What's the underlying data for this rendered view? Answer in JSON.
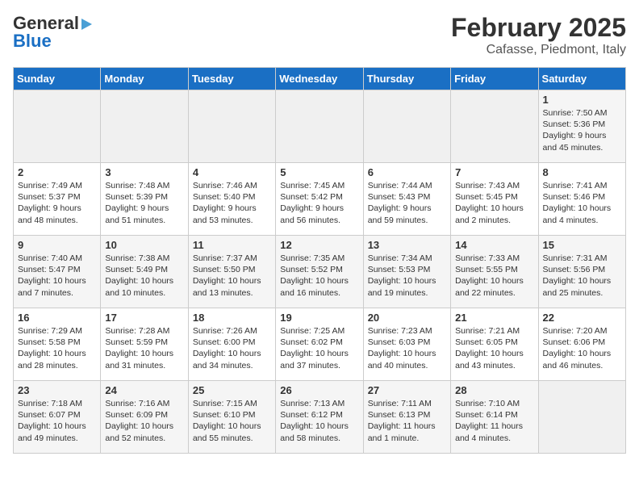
{
  "header": {
    "logo_general": "General",
    "logo_blue": "Blue",
    "title": "February 2025",
    "subtitle": "Cafasse, Piedmont, Italy"
  },
  "days_of_week": [
    "Sunday",
    "Monday",
    "Tuesday",
    "Wednesday",
    "Thursday",
    "Friday",
    "Saturday"
  ],
  "weeks": [
    [
      {
        "day": "",
        "info": ""
      },
      {
        "day": "",
        "info": ""
      },
      {
        "day": "",
        "info": ""
      },
      {
        "day": "",
        "info": ""
      },
      {
        "day": "",
        "info": ""
      },
      {
        "day": "",
        "info": ""
      },
      {
        "day": "1",
        "info": "Sunrise: 7:50 AM\nSunset: 5:36 PM\nDaylight: 9 hours and 45 minutes."
      }
    ],
    [
      {
        "day": "2",
        "info": "Sunrise: 7:49 AM\nSunset: 5:37 PM\nDaylight: 9 hours and 48 minutes."
      },
      {
        "day": "3",
        "info": "Sunrise: 7:48 AM\nSunset: 5:39 PM\nDaylight: 9 hours and 51 minutes."
      },
      {
        "day": "4",
        "info": "Sunrise: 7:46 AM\nSunset: 5:40 PM\nDaylight: 9 hours and 53 minutes."
      },
      {
        "day": "5",
        "info": "Sunrise: 7:45 AM\nSunset: 5:42 PM\nDaylight: 9 hours and 56 minutes."
      },
      {
        "day": "6",
        "info": "Sunrise: 7:44 AM\nSunset: 5:43 PM\nDaylight: 9 hours and 59 minutes."
      },
      {
        "day": "7",
        "info": "Sunrise: 7:43 AM\nSunset: 5:45 PM\nDaylight: 10 hours and 2 minutes."
      },
      {
        "day": "8",
        "info": "Sunrise: 7:41 AM\nSunset: 5:46 PM\nDaylight: 10 hours and 4 minutes."
      }
    ],
    [
      {
        "day": "9",
        "info": "Sunrise: 7:40 AM\nSunset: 5:47 PM\nDaylight: 10 hours and 7 minutes."
      },
      {
        "day": "10",
        "info": "Sunrise: 7:38 AM\nSunset: 5:49 PM\nDaylight: 10 hours and 10 minutes."
      },
      {
        "day": "11",
        "info": "Sunrise: 7:37 AM\nSunset: 5:50 PM\nDaylight: 10 hours and 13 minutes."
      },
      {
        "day": "12",
        "info": "Sunrise: 7:35 AM\nSunset: 5:52 PM\nDaylight: 10 hours and 16 minutes."
      },
      {
        "day": "13",
        "info": "Sunrise: 7:34 AM\nSunset: 5:53 PM\nDaylight: 10 hours and 19 minutes."
      },
      {
        "day": "14",
        "info": "Sunrise: 7:33 AM\nSunset: 5:55 PM\nDaylight: 10 hours and 22 minutes."
      },
      {
        "day": "15",
        "info": "Sunrise: 7:31 AM\nSunset: 5:56 PM\nDaylight: 10 hours and 25 minutes."
      }
    ],
    [
      {
        "day": "16",
        "info": "Sunrise: 7:29 AM\nSunset: 5:58 PM\nDaylight: 10 hours and 28 minutes."
      },
      {
        "day": "17",
        "info": "Sunrise: 7:28 AM\nSunset: 5:59 PM\nDaylight: 10 hours and 31 minutes."
      },
      {
        "day": "18",
        "info": "Sunrise: 7:26 AM\nSunset: 6:00 PM\nDaylight: 10 hours and 34 minutes."
      },
      {
        "day": "19",
        "info": "Sunrise: 7:25 AM\nSunset: 6:02 PM\nDaylight: 10 hours and 37 minutes."
      },
      {
        "day": "20",
        "info": "Sunrise: 7:23 AM\nSunset: 6:03 PM\nDaylight: 10 hours and 40 minutes."
      },
      {
        "day": "21",
        "info": "Sunrise: 7:21 AM\nSunset: 6:05 PM\nDaylight: 10 hours and 43 minutes."
      },
      {
        "day": "22",
        "info": "Sunrise: 7:20 AM\nSunset: 6:06 PM\nDaylight: 10 hours and 46 minutes."
      }
    ],
    [
      {
        "day": "23",
        "info": "Sunrise: 7:18 AM\nSunset: 6:07 PM\nDaylight: 10 hours and 49 minutes."
      },
      {
        "day": "24",
        "info": "Sunrise: 7:16 AM\nSunset: 6:09 PM\nDaylight: 10 hours and 52 minutes."
      },
      {
        "day": "25",
        "info": "Sunrise: 7:15 AM\nSunset: 6:10 PM\nDaylight: 10 hours and 55 minutes."
      },
      {
        "day": "26",
        "info": "Sunrise: 7:13 AM\nSunset: 6:12 PM\nDaylight: 10 hours and 58 minutes."
      },
      {
        "day": "27",
        "info": "Sunrise: 7:11 AM\nSunset: 6:13 PM\nDaylight: 11 hours and 1 minute."
      },
      {
        "day": "28",
        "info": "Sunrise: 7:10 AM\nSunset: 6:14 PM\nDaylight: 11 hours and 4 minutes."
      },
      {
        "day": "",
        "info": ""
      }
    ]
  ]
}
